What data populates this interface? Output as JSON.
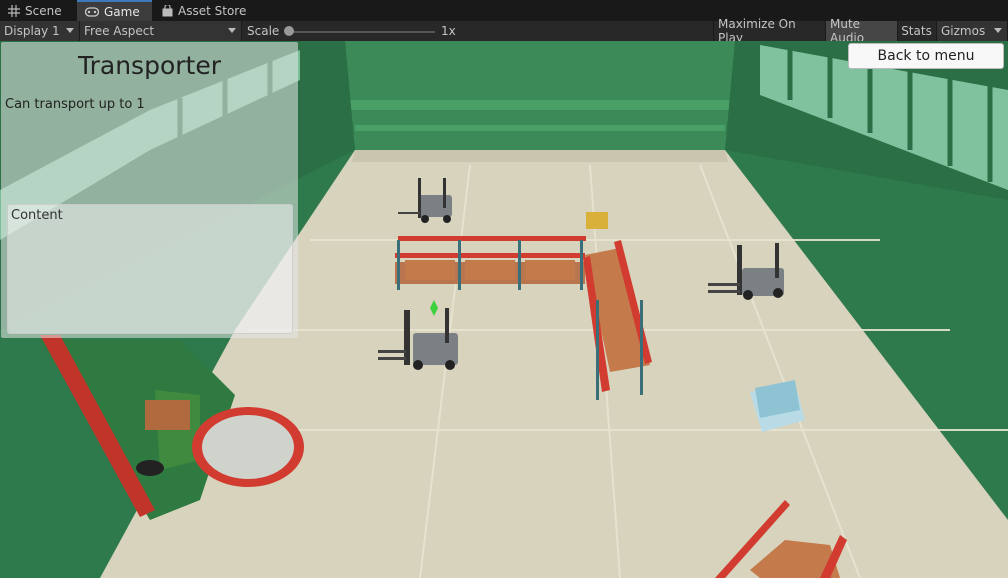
{
  "tabs": [
    {
      "label": "Scene",
      "icon": "grid-icon"
    },
    {
      "label": "Game",
      "icon": "gamepad-icon"
    },
    {
      "label": "Asset Store",
      "icon": "shopping-bag-icon"
    }
  ],
  "toolbar": {
    "display": "Display 1",
    "aspect": "Free Aspect",
    "scale_label": "Scale",
    "scale_value": "1x",
    "maximize": "Maximize On Play",
    "mute": "Mute Audio",
    "stats": "Stats",
    "gizmos": "Gizmos"
  },
  "panel": {
    "title": "Transporter",
    "description": "Can transport up to 1",
    "content_label": "Content"
  },
  "back_button": "Back to menu",
  "colors": {
    "accent": "#3a79bb",
    "floor": "#d7d3bd",
    "wall": "#2f7d4f",
    "shelf_red": "#d23b2f"
  }
}
